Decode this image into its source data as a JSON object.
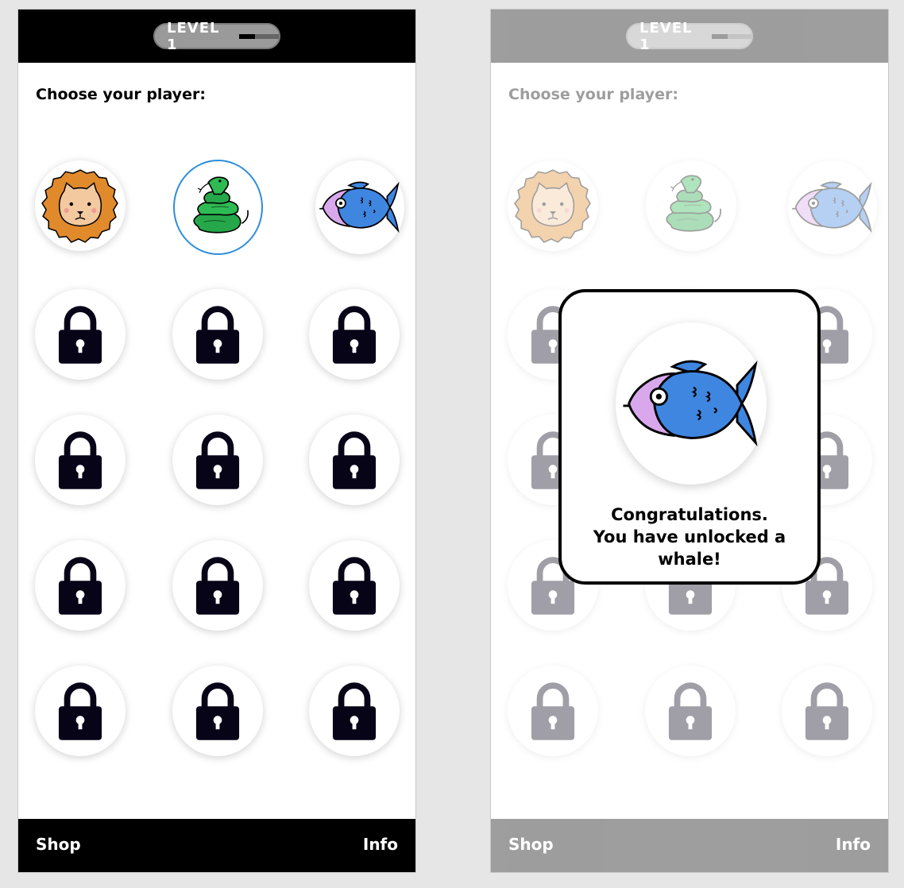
{
  "header": {
    "level_label": "LEVEL 1",
    "level_progress": 0.4
  },
  "picker": {
    "title": "Choose your player:",
    "unlocked_players": [
      {
        "animal": "lion",
        "icon": "lion-icon",
        "selected": false
      },
      {
        "animal": "snake",
        "icon": "snake-icon",
        "selected": true
      },
      {
        "animal": "fish",
        "icon": "fish-icon",
        "selected": false
      }
    ],
    "locked_count": 12,
    "locked_icon": "lock-icon"
  },
  "footer": {
    "shop_label": "Shop",
    "info_label": "Info"
  },
  "dialog": {
    "line1": "Congratulations.",
    "line2": "You have unlocked a",
    "line3": "whale!",
    "icon": "fish-icon"
  },
  "colors": {
    "selected_border": "#2e8ddb",
    "lock": "#070418",
    "lion_mane": "#e08a2c",
    "snake": "#26a84a",
    "fish_body": "#3f86e0",
    "fish_face": "#d9a8ec"
  }
}
